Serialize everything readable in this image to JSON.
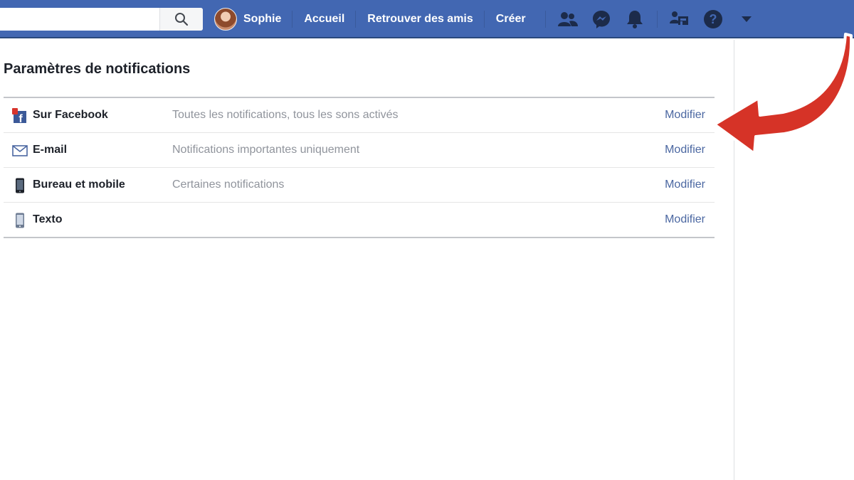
{
  "header": {
    "search": {
      "value": "",
      "placeholder": ""
    },
    "profile_name": "Sophie",
    "nav_items": [
      "Accueil",
      "Retrouver des amis",
      "Créer"
    ],
    "icons": [
      "friends-icon",
      "messenger-icon",
      "notifications-bell-icon",
      "find-friends-icon",
      "help-icon",
      "dropdown-arrow-icon"
    ]
  },
  "page": {
    "title": "Paramètres de notifications",
    "rows": [
      {
        "icon": "facebook-notification-icon",
        "label": "Sur Facebook",
        "description": "Toutes les notifications, tous les sons activés",
        "action": "Modifier"
      },
      {
        "icon": "envelope-icon",
        "label": "E-mail",
        "description": "Notifications importantes uniquement",
        "action": "Modifier"
      },
      {
        "icon": "phone-icon",
        "label": "Bureau et mobile",
        "description": "Certaines notifications",
        "action": "Modifier"
      },
      {
        "icon": "sms-phone-icon",
        "label": "Texto",
        "description": "",
        "action": "Modifier"
      }
    ]
  },
  "colors": {
    "topbar": "#4267b2",
    "link": "#4b67a1",
    "annotation_arrow": "#d63327"
  }
}
